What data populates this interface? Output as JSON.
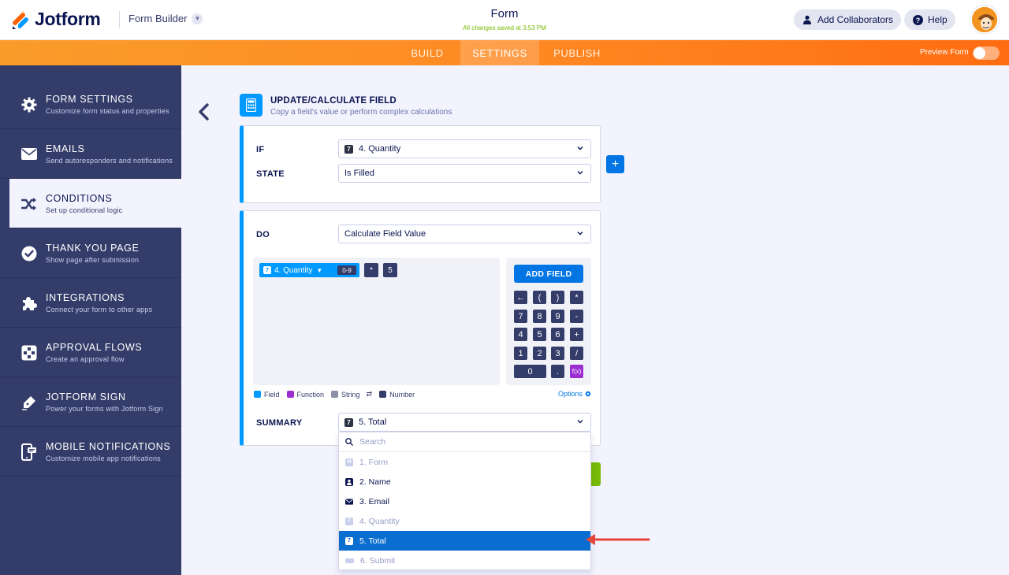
{
  "header": {
    "logo_text": "Jotform",
    "builder_label": "Form Builder",
    "form_title": "Form",
    "saved_status": "All changes saved at 3:53 PM",
    "add_collaborators": "Add Collaborators",
    "help": "Help"
  },
  "nav": {
    "tabs": [
      "BUILD",
      "SETTINGS",
      "PUBLISH"
    ],
    "active_tab": "SETTINGS",
    "preview_label": "Preview Form",
    "preview_enabled": false
  },
  "sidebar": {
    "items": [
      {
        "title": "FORM SETTINGS",
        "subtitle": "Customize form status and properties",
        "icon": "gear-icon"
      },
      {
        "title": "EMAILS",
        "subtitle": "Send autoresponders and notifications",
        "icon": "envelope-icon"
      },
      {
        "title": "CONDITIONS",
        "subtitle": "Set up conditional logic",
        "icon": "shuffle-icon"
      },
      {
        "title": "THANK YOU PAGE",
        "subtitle": "Show page after submission",
        "icon": "check-circle-icon"
      },
      {
        "title": "INTEGRATIONS",
        "subtitle": "Connect your form to other apps",
        "icon": "puzzle-icon"
      },
      {
        "title": "APPROVAL FLOWS",
        "subtitle": "Create an approval flow",
        "icon": "approval-flow-icon"
      },
      {
        "title": "JOTFORM SIGN",
        "subtitle": "Power your forms with Jotform Sign",
        "icon": "pen-sign-icon"
      },
      {
        "title": "MOBILE NOTIFICATIONS",
        "subtitle": "Customize mobile app notifications",
        "icon": "mobile-notification-icon"
      }
    ],
    "active_index": 2
  },
  "condition": {
    "title": "UPDATE/CALCULATE FIELD",
    "subtitle": "Copy a field's value or perform complex calculations",
    "if_label": "IF",
    "if_value": "4. Quantity",
    "state_label": "STATE",
    "state_value": "Is Filled",
    "do_label": "DO",
    "do_value": "Calculate Field Value",
    "formula": {
      "field_chip": "4. Quantity",
      "range_chip": "0-9",
      "operator": "*",
      "operand": "5"
    },
    "keypad": {
      "add_field": "ADD FIELD",
      "rows": [
        [
          "←",
          "(",
          ")",
          "*"
        ],
        [
          "7",
          "8",
          "9",
          "-"
        ],
        [
          "4",
          "5",
          "6",
          "+"
        ],
        [
          "1",
          "2",
          "3",
          "/"
        ],
        [
          "0",
          ".",
          "f(x)"
        ]
      ]
    },
    "legend": [
      {
        "label": "Field",
        "color": "#0099ff"
      },
      {
        "label": "Function",
        "color": "#9b2dd1"
      },
      {
        "label": "String",
        "color": "#8d8fa8"
      },
      {
        "label": "Number",
        "color": "#343c6a"
      }
    ],
    "options_label": "Options",
    "summary_label": "SUMMARY",
    "summary_value": "5. Total",
    "dropdown": {
      "search_placeholder": "Search",
      "items": [
        {
          "label": "1. Form",
          "icon": "heading-icon",
          "disabled": true
        },
        {
          "label": "2. Name",
          "icon": "person-icon",
          "disabled": false
        },
        {
          "label": "3. Email",
          "icon": "envelope-icon",
          "disabled": false
        },
        {
          "label": "4. Quantity",
          "icon": "number-icon",
          "disabled": true
        },
        {
          "label": "5. Total",
          "icon": "number-icon",
          "selected": true
        },
        {
          "label": "6. Submit",
          "icon": "submit-icon",
          "disabled": true
        }
      ]
    }
  },
  "colors": {
    "accent_blue": "#0099ff",
    "button_blue": "#0075e3",
    "sidebar_bg": "#343c6a",
    "nav_orange": "#ff8a24",
    "green": "#78bb07"
  }
}
